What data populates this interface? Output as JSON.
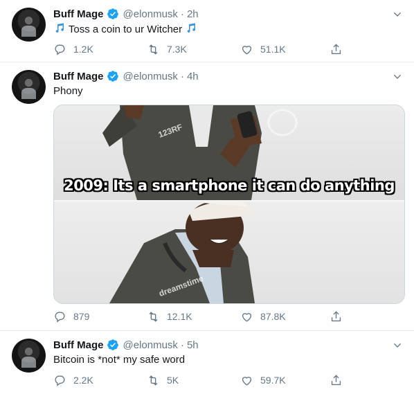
{
  "tweets": [
    {
      "name": "Buff Mage",
      "handle": "@elonmusk",
      "time": "2h",
      "text": "Toss a coin to ur Witcher",
      "replies": "1.2K",
      "retweets": "7.3K",
      "likes": "51.1K"
    },
    {
      "name": "Buff Mage",
      "handle": "@elonmusk",
      "time": "4h",
      "text": "Phony",
      "media_caption": "2009: Its a smartphone it can do anything",
      "media_watermarks": [
        "123RF",
        "dreamstime"
      ],
      "replies": "879",
      "retweets": "12.1K",
      "likes": "87.8K"
    },
    {
      "name": "Buff Mage",
      "handle": "@elonmusk",
      "time": "5h",
      "text": "Bitcoin is *not* my safe word",
      "replies": "2.2K",
      "retweets": "5K",
      "likes": "59.7K"
    }
  ],
  "separator": "·",
  "colors": {
    "accent": "#1da1f2",
    "muted": "#657786",
    "text": "#14171a",
    "border": "#e6ecf0"
  },
  "icons": [
    "verified-badge-icon",
    "chevron-down-icon",
    "reply-icon",
    "retweet-icon",
    "like-icon",
    "share-icon",
    "music-note-icon"
  ]
}
